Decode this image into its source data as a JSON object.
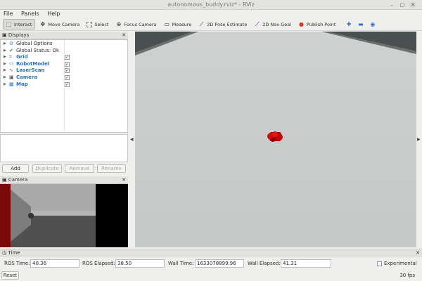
{
  "window": {
    "title": "autonomous_buddy.rviz* - RViz"
  },
  "menu": [
    "File",
    "Panels",
    "Help"
  ],
  "toolbar": {
    "tools": [
      {
        "label": "Interact",
        "icon": "interact-icon",
        "active": true
      },
      {
        "label": "Move Camera",
        "icon": "move-camera-icon",
        "active": false
      },
      {
        "label": "Select",
        "icon": "select-icon",
        "active": false
      },
      {
        "label": "Focus Camera",
        "icon": "focus-camera-icon",
        "active": false
      },
      {
        "label": "Measure",
        "icon": "measure-icon",
        "active": false
      },
      {
        "label": "2D Pose Estimate",
        "icon": "pose-estimate-icon",
        "active": false
      },
      {
        "label": "2D Nav Goal",
        "icon": "nav-goal-icon",
        "active": false
      },
      {
        "label": "Publish Point",
        "icon": "publish-point-icon",
        "active": false
      }
    ]
  },
  "displays": {
    "title": "Displays",
    "items": [
      {
        "label": "Global Options",
        "icon": "gear-icon",
        "plugin": false,
        "checkbox": false
      },
      {
        "label": "Global Status: Ok",
        "icon": "check-icon",
        "plugin": false,
        "checkbox": false
      },
      {
        "label": "Grid",
        "icon": "grid-icon",
        "plugin": true,
        "checkbox": true
      },
      {
        "label": "RobotModel",
        "icon": "robot-model-icon",
        "plugin": true,
        "checkbox": true
      },
      {
        "label": "LaserScan",
        "icon": "laser-scan-icon",
        "plugin": true,
        "checkbox": true
      },
      {
        "label": "Camera",
        "icon": "camera-icon",
        "plugin": true,
        "checkbox": true
      },
      {
        "label": "Map",
        "icon": "map-icon",
        "plugin": true,
        "checkbox": true
      }
    ],
    "buttons": {
      "add": "Add",
      "duplicate": "Duplicate",
      "remove": "Remove",
      "rename": "Rename"
    }
  },
  "camera_panel": {
    "title": "Camera"
  },
  "time_panel": {
    "title": "Time",
    "ros_time_label": "ROS Time:",
    "ros_time": "40.36",
    "ros_elapsed_label": "ROS Elapsed:",
    "ros_elapsed": "38.50",
    "wall_time_label": "Wall Time:",
    "wall_time": "1633078899.96",
    "wall_elapsed_label": "Wall Elapsed:",
    "wall_elapsed": "41.31",
    "experimental_label": "Experimental"
  },
  "status": {
    "reset_label": "Reset",
    "fps": "30 fps"
  }
}
